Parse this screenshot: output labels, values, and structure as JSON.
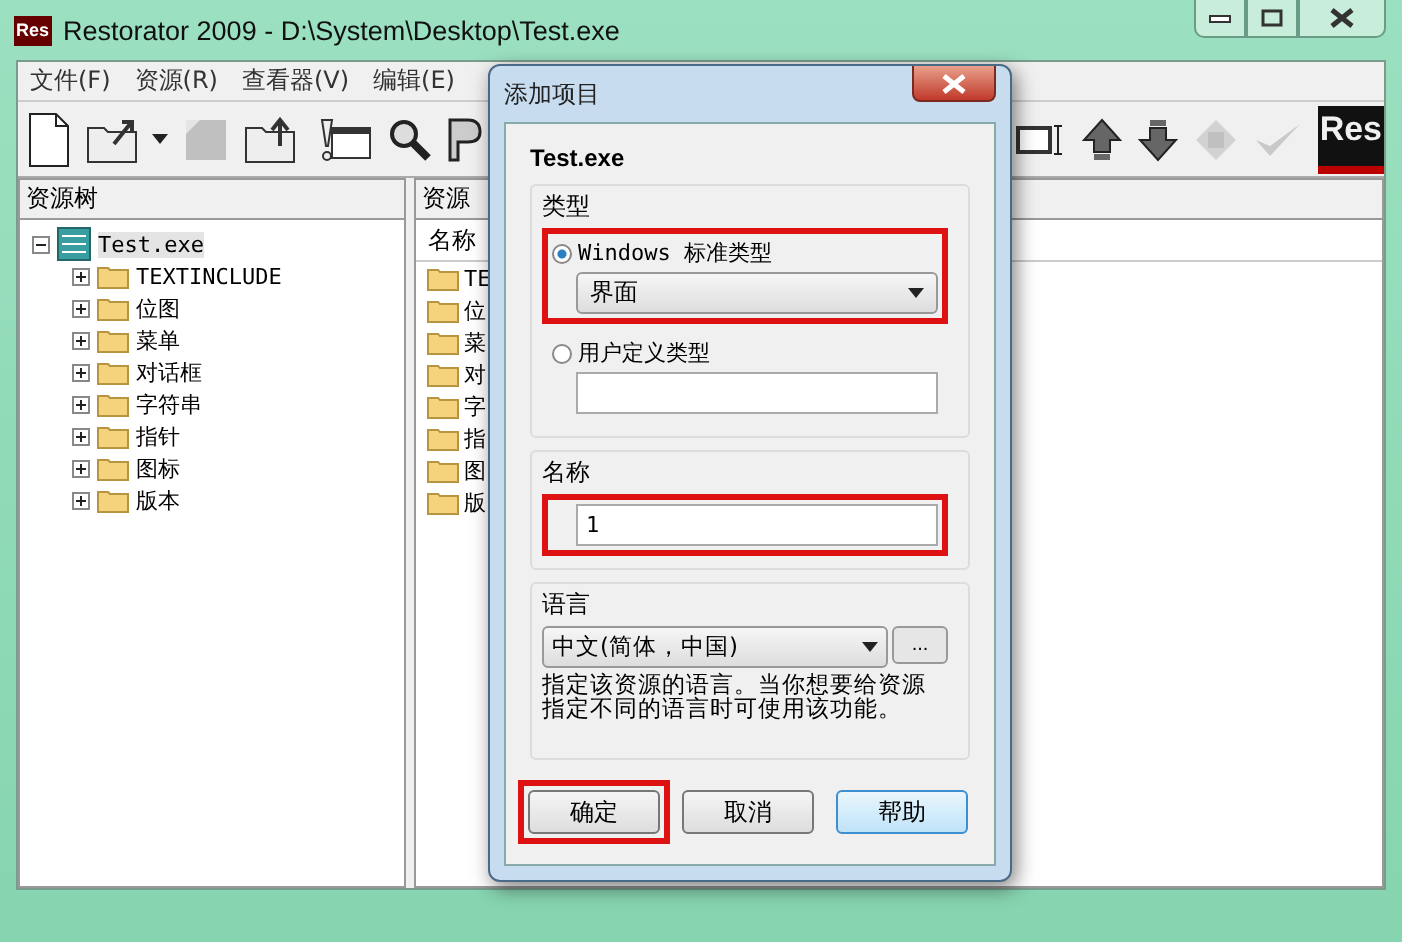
{
  "window": {
    "icon_text": "Res",
    "title": "Restorator 2009 - D:\\System\\Desktop\\Test.exe"
  },
  "menu": [
    "文件(F)",
    "资源(R)",
    "查看器(V)",
    "编辑(E)"
  ],
  "toolbar_left": [
    {
      "kind": "new",
      "disabled": false
    },
    {
      "kind": "open",
      "disabled": false
    },
    {
      "kind": "caret",
      "disabled": false
    },
    {
      "kind": "square",
      "disabled": true
    },
    {
      "kind": "folder-out",
      "disabled": false
    },
    {
      "kind": "alert",
      "disabled": false
    },
    {
      "kind": "search",
      "disabled": false
    },
    {
      "kind": "rp",
      "disabled": false
    }
  ],
  "toolbar_right": [
    {
      "kind": "text",
      "disabled": false
    },
    {
      "kind": "up",
      "disabled": false
    },
    {
      "kind": "down",
      "disabled": false
    },
    {
      "kind": "diamond",
      "disabled": true
    },
    {
      "kind": "check",
      "disabled": true
    }
  ],
  "logo_text": "Res",
  "tree_panel": {
    "header": "资源树",
    "root": {
      "label": "Test.exe",
      "expanded": true,
      "selected": true,
      "children": [
        {
          "label": "TEXTINCLUDE",
          "expanded": false,
          "selected": false
        },
        {
          "label": "位图",
          "expanded": false,
          "selected": false
        },
        {
          "label": "菜单",
          "expanded": false,
          "selected": false
        },
        {
          "label": "对话框",
          "expanded": false,
          "selected": false
        },
        {
          "label": "字符串",
          "expanded": false,
          "selected": false
        },
        {
          "label": "指针",
          "expanded": false,
          "selected": false
        },
        {
          "label": "图标",
          "expanded": false,
          "selected": false
        },
        {
          "label": "版本",
          "expanded": false,
          "selected": false
        }
      ]
    }
  },
  "list_panel": {
    "header": "资源",
    "column": "名称",
    "items": [
      "TE",
      "位",
      "菜",
      "对",
      "字",
      "指",
      "图",
      "版"
    ]
  },
  "dialog": {
    "title": "添加项目",
    "file": "Test.exe",
    "type_group": {
      "label": "类型",
      "options": [
        {
          "label": "Windows 标准类型",
          "selected": true,
          "highlighted": true,
          "value": "界面"
        },
        {
          "label": "用户定义类型",
          "selected": false,
          "highlighted": false
        }
      ]
    },
    "name_group": {
      "label": "名称",
      "value": "1",
      "highlighted": true
    },
    "language_group": {
      "label": "语言",
      "value": "中文(简体，中国)",
      "more": "...",
      "description": "指定该资源的语言。当你想要给资源指定不同的语言时可使用该功能。"
    },
    "buttons": [
      {
        "label": "确定",
        "highlighted": true,
        "default": false
      },
      {
        "label": "取消",
        "highlighted": false,
        "default": false
      },
      {
        "label": "帮助",
        "highlighted": false,
        "default": true
      }
    ]
  }
}
